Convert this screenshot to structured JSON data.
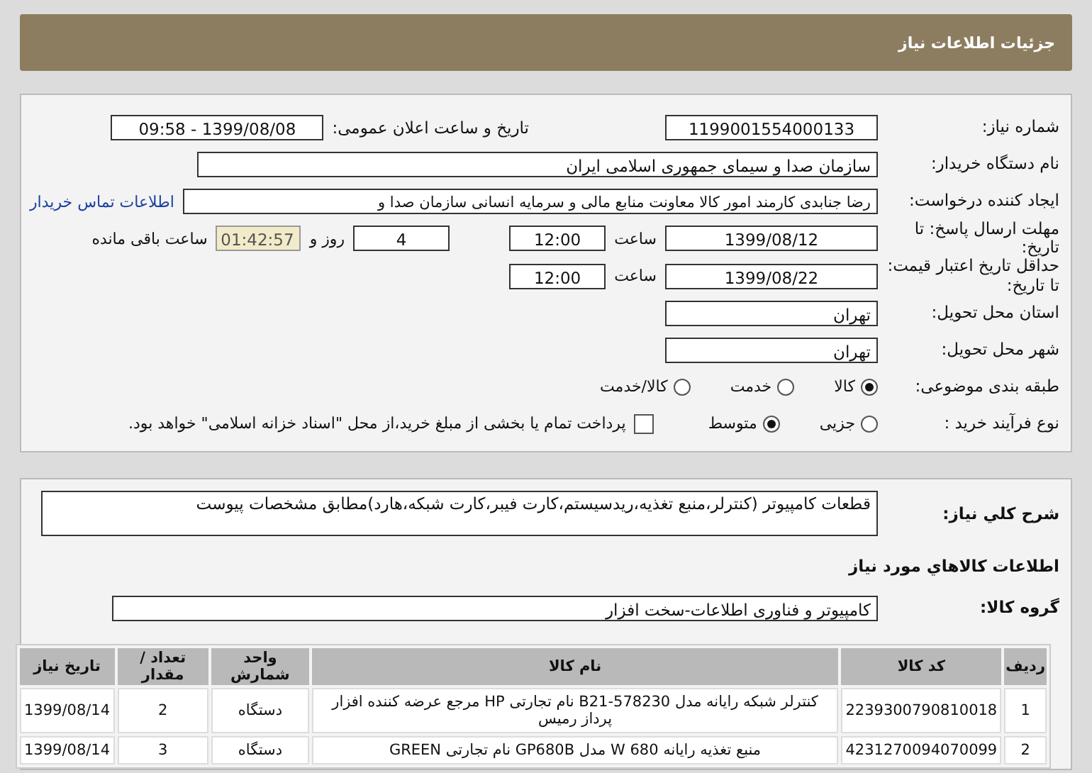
{
  "header": {
    "title": "جزئیات اطلاعات نیاز"
  },
  "form": {
    "need_number": {
      "label": "شماره نیاز:",
      "value": "1199001554000133"
    },
    "announce": {
      "label": "تاریخ و ساعت اعلان عمومی:",
      "value": "1399/08/08 - 09:58"
    },
    "buyer": {
      "label": "نام دستگاه خریدار:",
      "value": "سازمان صدا و سیمای جمهوری اسلامی ایران"
    },
    "creator": {
      "label": "ایجاد کننده درخواست:",
      "value": "رضا جنابدی کارمند امور کالا معاونت منابع مالی و سرمایه انسانی سازمان صدا و",
      "link": "اطلاعات تماس خریدار"
    },
    "deadline": {
      "label": "مهلت ارسال پاسخ: تا تاریخ:",
      "date": "1399/08/12",
      "time_label": "ساعت",
      "time": "12:00",
      "days": "4",
      "days_label": "روز و",
      "remaining": "01:42:57",
      "remaining_label": "ساعت باقی مانده"
    },
    "validity": {
      "label": "حداقل تاریخ اعتبار قیمت: تا تاریخ:",
      "date": "1399/08/22",
      "time_label": "ساعت",
      "time": "12:00"
    },
    "province": {
      "label": "استان محل تحویل:",
      "value": "تهران"
    },
    "city": {
      "label": "شهر محل تحویل:",
      "value": "تهران"
    },
    "category": {
      "label": "طبقه بندی موضوعی:",
      "options": [
        {
          "label": "کالا",
          "selected": true
        },
        {
          "label": "خدمت",
          "selected": false
        },
        {
          "label": "کالا/خدمت",
          "selected": false
        }
      ]
    },
    "process": {
      "label": "نوع فرآیند خرید :",
      "options": [
        {
          "label": "جزیی",
          "selected": false
        },
        {
          "label": "متوسط",
          "selected": true
        }
      ],
      "treasury": {
        "label": "پرداخت تمام یا بخشی از مبلغ خرید،از محل \"اسناد خزانه اسلامی\" خواهد بود.",
        "checked": false
      }
    }
  },
  "description": {
    "label": "شرح کلي نیاز:",
    "value": "قطعات کامپیوتر (کنترلر،منبع تغذیه،ریدسیستم،کارت فیبر،کارت شبکه،هارد)مطابق مشخصات پیوست"
  },
  "goods_heading": "اطلاعات کالاهاي مورد نیاز",
  "goods_group": {
    "label": "گروه کالا:",
    "value": "کامپیوتر و فناوری اطلاعات-سخت افزار"
  },
  "table": {
    "columns": [
      "ردیف",
      "کد کالا",
      "نام کالا",
      "واحد شمارش",
      "تعداد / مقدار",
      "تاریخ نیاز"
    ],
    "rows": [
      [
        "1",
        "2239300790810018",
        "کنترلر شبکه رایانه مدل B21-578230 نام تجارتی HP مرجع عرضه کننده افزار پرداز رمیس",
        "دستگاه",
        "2",
        "1399/08/14"
      ],
      [
        "2",
        "4231270094070099",
        "منبع تغذیه رایانه 680 W مدل GP680B نام تجارتی GREEN",
        "دستگاه",
        "3",
        "1399/08/14"
      ]
    ]
  }
}
